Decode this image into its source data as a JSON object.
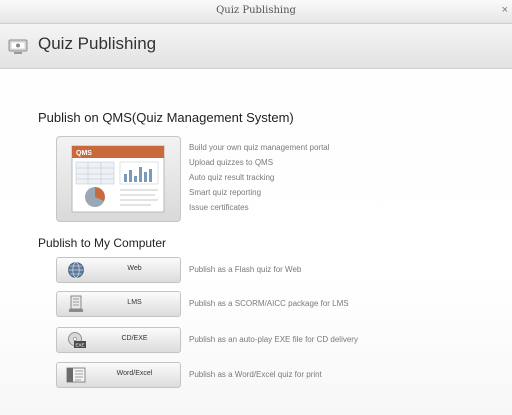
{
  "window": {
    "title": "Quiz Publishing",
    "close_glyph": "×"
  },
  "header": {
    "title": "Quiz Publishing",
    "icon": "quiz-publishing-icon"
  },
  "qms_section": {
    "heading": "Publish on QMS(Quiz Management System)",
    "card_logo": "QMS",
    "features": [
      "Build your own quiz management portal",
      "Upload quizzes to QMS",
      "Auto quiz result tracking",
      "Smart quiz reporting",
      "Issue certificates"
    ]
  },
  "computer_section": {
    "heading": "Publish to My Computer",
    "options": [
      {
        "label": "Web",
        "icon": "globe-icon",
        "description": "Publish as a Flash quiz for Web"
      },
      {
        "label": "LMS",
        "icon": "lms-icon",
        "description": "Publish as a SCORM/AICC package for LMS"
      },
      {
        "label": "CD/EXE",
        "icon": "cd-exe-icon",
        "description": "Publish as an auto-play EXE file for CD delivery"
      },
      {
        "label": "Word/Excel",
        "icon": "word-excel-icon",
        "description": "Publish as a Word/Excel quiz for print"
      }
    ]
  },
  "colors": {
    "accent": "#c86a3c",
    "muted_text": "#7a7a7a"
  }
}
